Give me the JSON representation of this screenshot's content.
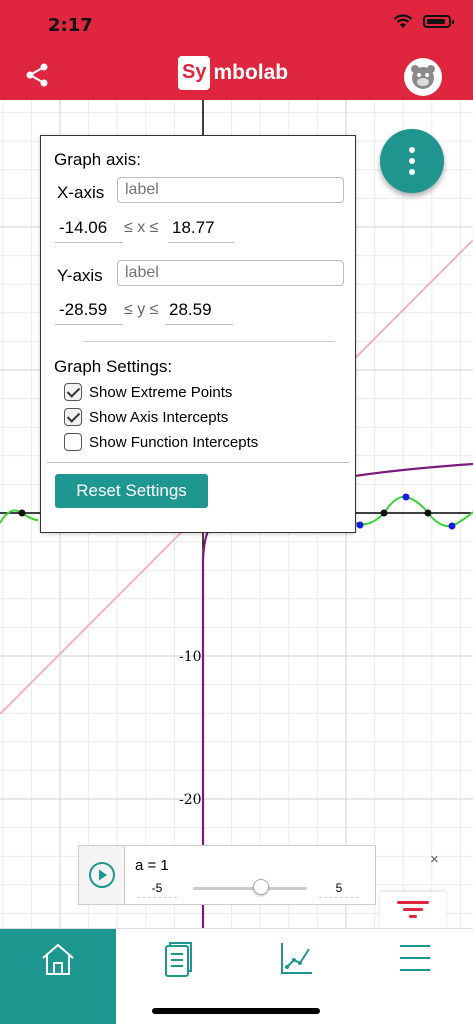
{
  "status_bar": {
    "time": "2:17"
  },
  "header": {
    "logo_highlight": "Sy",
    "logo_rest": "mbolab",
    "brand_color": "#e0263e"
  },
  "graph": {
    "y_tick_labels": [
      "-10",
      "-20"
    ],
    "curve_colors": {
      "line": "#f5b3c0",
      "log": "#7a1a7a",
      "sine": "#3cd23c"
    }
  },
  "settings_panel": {
    "title": "Graph axis:",
    "x_axis": {
      "name": "X-axis",
      "label_placeholder": "label",
      "min": "-14.06",
      "op": "≤ x ≤",
      "max": "18.77"
    },
    "y_axis": {
      "name": "Y-axis",
      "label_placeholder": "label",
      "min": "-28.59",
      "op": "≤ y ≤",
      "max": "28.59"
    },
    "settings_title": "Graph Settings:",
    "options": [
      {
        "label": "Show Extreme Points",
        "checked": true
      },
      {
        "label": "Show Axis Intercepts",
        "checked": true
      },
      {
        "label": "Show Function Intercepts",
        "checked": false
      }
    ],
    "reset_label": "Reset Settings"
  },
  "slider": {
    "expression": "a = 1",
    "min": "-5",
    "max": "5",
    "value_fraction": 0.6,
    "close": "×"
  },
  "bottom_nav": {
    "items": [
      "home-icon",
      "notebook-icon",
      "graph-icon",
      "menu-icon"
    ],
    "active_index": 0,
    "accent_color": "#1f9791"
  }
}
